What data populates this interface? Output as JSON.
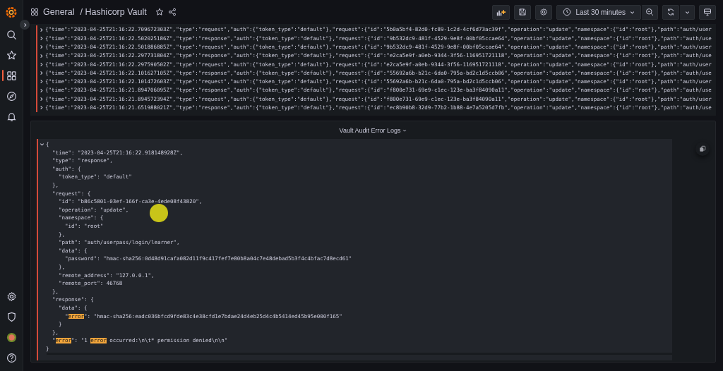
{
  "sidebar": {
    "items": [
      {
        "selected": false
      },
      {
        "selected": false
      },
      {
        "selected": true
      },
      {
        "selected": false
      },
      {
        "selected": false
      },
      {
        "selected": false
      },
      {
        "selected": false
      },
      {
        "selected": false
      },
      {
        "selected": false
      }
    ]
  },
  "breadcrumb": {
    "folder": "General",
    "dashboard": "/ Hashicorp Vault",
    "starred": false
  },
  "toolbar": {
    "time_range": "Last 30 minutes"
  },
  "log_rows": [
    {
      "expanded": false,
      "text": "{\"time\":\"2023-04-25T21:16:22.709672303Z\",\"type\":\"request\",\"auth\":{\"token_type\":\"default\"},\"request\":{\"id\":\"5b0a5bf4-82d0-fc89-1c2d-4cf6d73ac39f\",\"operation\":\"update\",\"namespace\":{\"id\":\"root\"},\"path\":\"auth/user"
    },
    {
      "expanded": false,
      "text": "{\"time\":\"2023-04-25T21:16:22.502025186Z\",\"type\":\"response\",\"auth\":{\"token_type\":\"default\"},\"request\":{\"id\":\"9b532dc9-481f-4529-9e8f-00bf05ccae64\",\"operation\":\"update\",\"namespace\":{\"id\":\"root\"},\"path\":\"auth/use"
    },
    {
      "expanded": false,
      "text": "{\"time\":\"2023-04-25T21:16:22.501886885Z\",\"type\":\"request\",\"auth\":{\"token_type\":\"default\"},\"request\":{\"id\":\"9b532dc9-481f-4529-9e8f-00bf05ccae64\",\"operation\":\"update\",\"namespace\":{\"id\":\"root\"},\"path\":\"auth/user"
    },
    {
      "expanded": false,
      "text": "{\"time\":\"2023-04-25T21:16:22.297731804Z\",\"type\":\"response\",\"auth\":{\"token_type\":\"default\"},\"request\":{\"id\":\"e2ca5e9f-a0eb-9344-3f56-116951721118\",\"operation\":\"update\",\"namespace\":{\"id\":\"root\"},\"path\":\"auth/use"
    },
    {
      "expanded": false,
      "text": "{\"time\":\"2023-04-25T21:16:22.297590502Z\",\"type\":\"request\",\"auth\":{\"token_type\":\"default\"},\"request\":{\"id\":\"e2ca5e9f-a0eb-9344-3f56-116951721118\",\"operation\":\"update\",\"namespace\":{\"id\":\"root\"},\"path\":\"auth/user"
    },
    {
      "expanded": false,
      "text": "{\"time\":\"2023-04-25T21:16:22.101627105Z\",\"type\":\"response\",\"auth\":{\"token_type\":\"default\"},\"request\":{\"id\":\"55692a6b-b21c-6da0-795a-bd2c1d5ccb06\",\"operation\":\"update\",\"namespace\":{\"id\":\"root\"},\"path\":\"auth/use"
    },
    {
      "expanded": false,
      "text": "{\"time\":\"2023-04-25T21:16:22.101472603Z\",\"type\":\"request\",\"auth\":{\"token_type\":\"default\"},\"request\":{\"id\":\"55692a6b-b21c-6da0-795a-bd2c1d5ccb06\",\"operation\":\"update\",\"namespace\":{\"id\":\"root\"},\"path\":\"auth/user"
    },
    {
      "expanded": false,
      "text": "{\"time\":\"2023-04-25T21:16:21.894706095Z\",\"type\":\"response\",\"auth\":{\"token_type\":\"default\"},\"request\":{\"id\":\"f800e731-69e9-c1ec-123e-ba3f84090a11\",\"operation\":\"update\",\"namespace\":{\"id\":\"root\"},\"path\":\"auth/use"
    },
    {
      "expanded": false,
      "text": "{\"time\":\"2023-04-25T21:16:21.894572394Z\",\"type\":\"request\",\"auth\":{\"token_type\":\"default\"},\"request\":{\"id\":\"f800e731-69e9-c1ec-123e-ba3f84090a11\",\"operation\":\"update\",\"namespace\":{\"id\":\"root\"},\"path\":\"auth/user"
    },
    {
      "expanded": false,
      "text": "{\"time\":\"2023-04-25T21:16:21.651988021Z\",\"type\":\"response\",\"auth\":{\"token_type\":\"default\"},\"request\":{\"id\":\"ec8b90b8-32d9-77b2-1b88-4e7a5205d7fb\",\"operation\":\"update\",\"namespace\":{\"id\":\"root\"},\"path\":\"auth/use"
    }
  ],
  "panel": {
    "title": "Vault Audit Error Logs",
    "expanded_log": {
      "expanded": true,
      "open": "{",
      "close": "}",
      "lines": [
        {
          "text": "\"time\": \"2023-04-25T21:16:22.918148928Z\","
        },
        {
          "text": "\"type\": \"response\","
        },
        {
          "text": "\"auth\": {",
          "children": [
            {
              "text": "\"token_type\": \"default\""
            }
          ],
          "close": "},"
        },
        {
          "text": "\"request\": {",
          "children": [
            {
              "text": "\"id\": \"b86c5801-03ef-166f-ca3e-4ede08f43820\","
            },
            {
              "text": "\"operation\": \"update\","
            },
            {
              "text": "\"namespace\": {",
              "children": [
                {
                  "text": "\"id\": \"root\""
                }
              ],
              "close": "},"
            },
            {
              "text": "\"path\": \"auth/userpass/login/learner\","
            },
            {
              "text": "\"data\": {",
              "children": [
                {
                  "text": "\"password\": \"hmac-sha256:0d48d91cafa082d11f9c417fef7e80b8a04c7e48debad5b3f4c4bfac7d8ecd61\""
                }
              ],
              "close": "},"
            },
            {
              "text": "\"remote_address\": \"127.0.0.1\","
            },
            {
              "text": "\"remote_port\": 46768"
            }
          ],
          "close": "},"
        },
        {
          "text": "\"response\": {",
          "children": [
            {
              "text": "\"data\": {",
              "children": [
                {
                  "parts": [
                    {
                      "text": "\"",
                      "highlight": false
                    },
                    {
                      "text": "error",
                      "highlight": true
                    },
                    {
                      "text": "\": \"hmac-sha256:eadc036bfcd9fde83c4e38cfd1e7bdae24d4eb25d4c4b5414ed45b95e000f165\"",
                      "highlight": false
                    }
                  ]
                }
              ],
              "close": "}"
            }
          ],
          "close": "},"
        },
        {
          "parts": [
            {
              "text": "\"",
              "highlight": false
            },
            {
              "text": "error",
              "highlight": true
            },
            {
              "text": "\": \"1 ",
              "highlight": false
            },
            {
              "text": "error",
              "highlight": true
            },
            {
              "text": " occurred:\\n\\t* permission denied\\n\\n\"",
              "highlight": false
            }
          ]
        }
      ]
    }
  }
}
